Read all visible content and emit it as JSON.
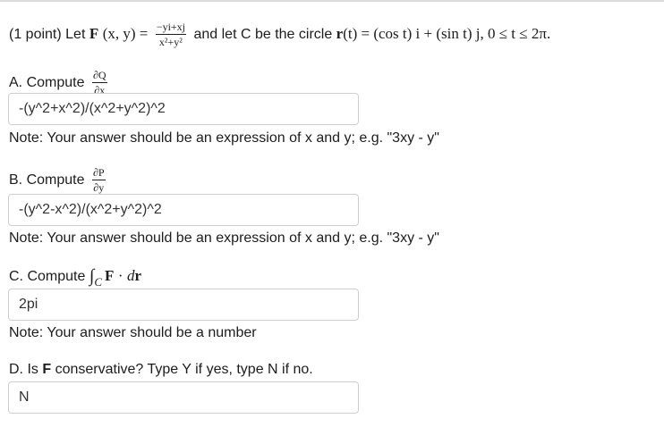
{
  "problem": {
    "intro": "(1 point) Let",
    "F": "F",
    "args": "(x, y) =",
    "num": "−yi+xj",
    "den": "x²+y²",
    "mid": "and let C be the circle",
    "r": "r",
    "rt": "(t) = (cos t) i + (sin t) j, 0 ≤ t ≤ 2π."
  },
  "partA": {
    "label": "A. Compute",
    "num": "∂Q",
    "den": "∂x",
    "answer": "-(y^2+x^2)/(x^2+y^2)^2",
    "note": "Note: Your answer should be an expression of x and y; e.g. \"3xy - y\""
  },
  "partB": {
    "label": "B. Compute",
    "num": "∂P",
    "den": "∂y",
    "answer": "-(y^2-x^2)/(x^2+y^2)^2",
    "note": "Note: Your answer should be an expression of x and y; e.g. \"3xy - y\""
  },
  "partC": {
    "label": "C. Compute",
    "integral": "∫",
    "sub": "C",
    "F": "F",
    "dot": "·",
    "d": "d",
    "r": "r",
    "answer": "2pi",
    "note": "Note: Your answer should be a number"
  },
  "partD": {
    "prefix": "D. Is",
    "F": "F",
    "suffix": "conservative? Type Y if yes, type N if no.",
    "answer": "N"
  }
}
